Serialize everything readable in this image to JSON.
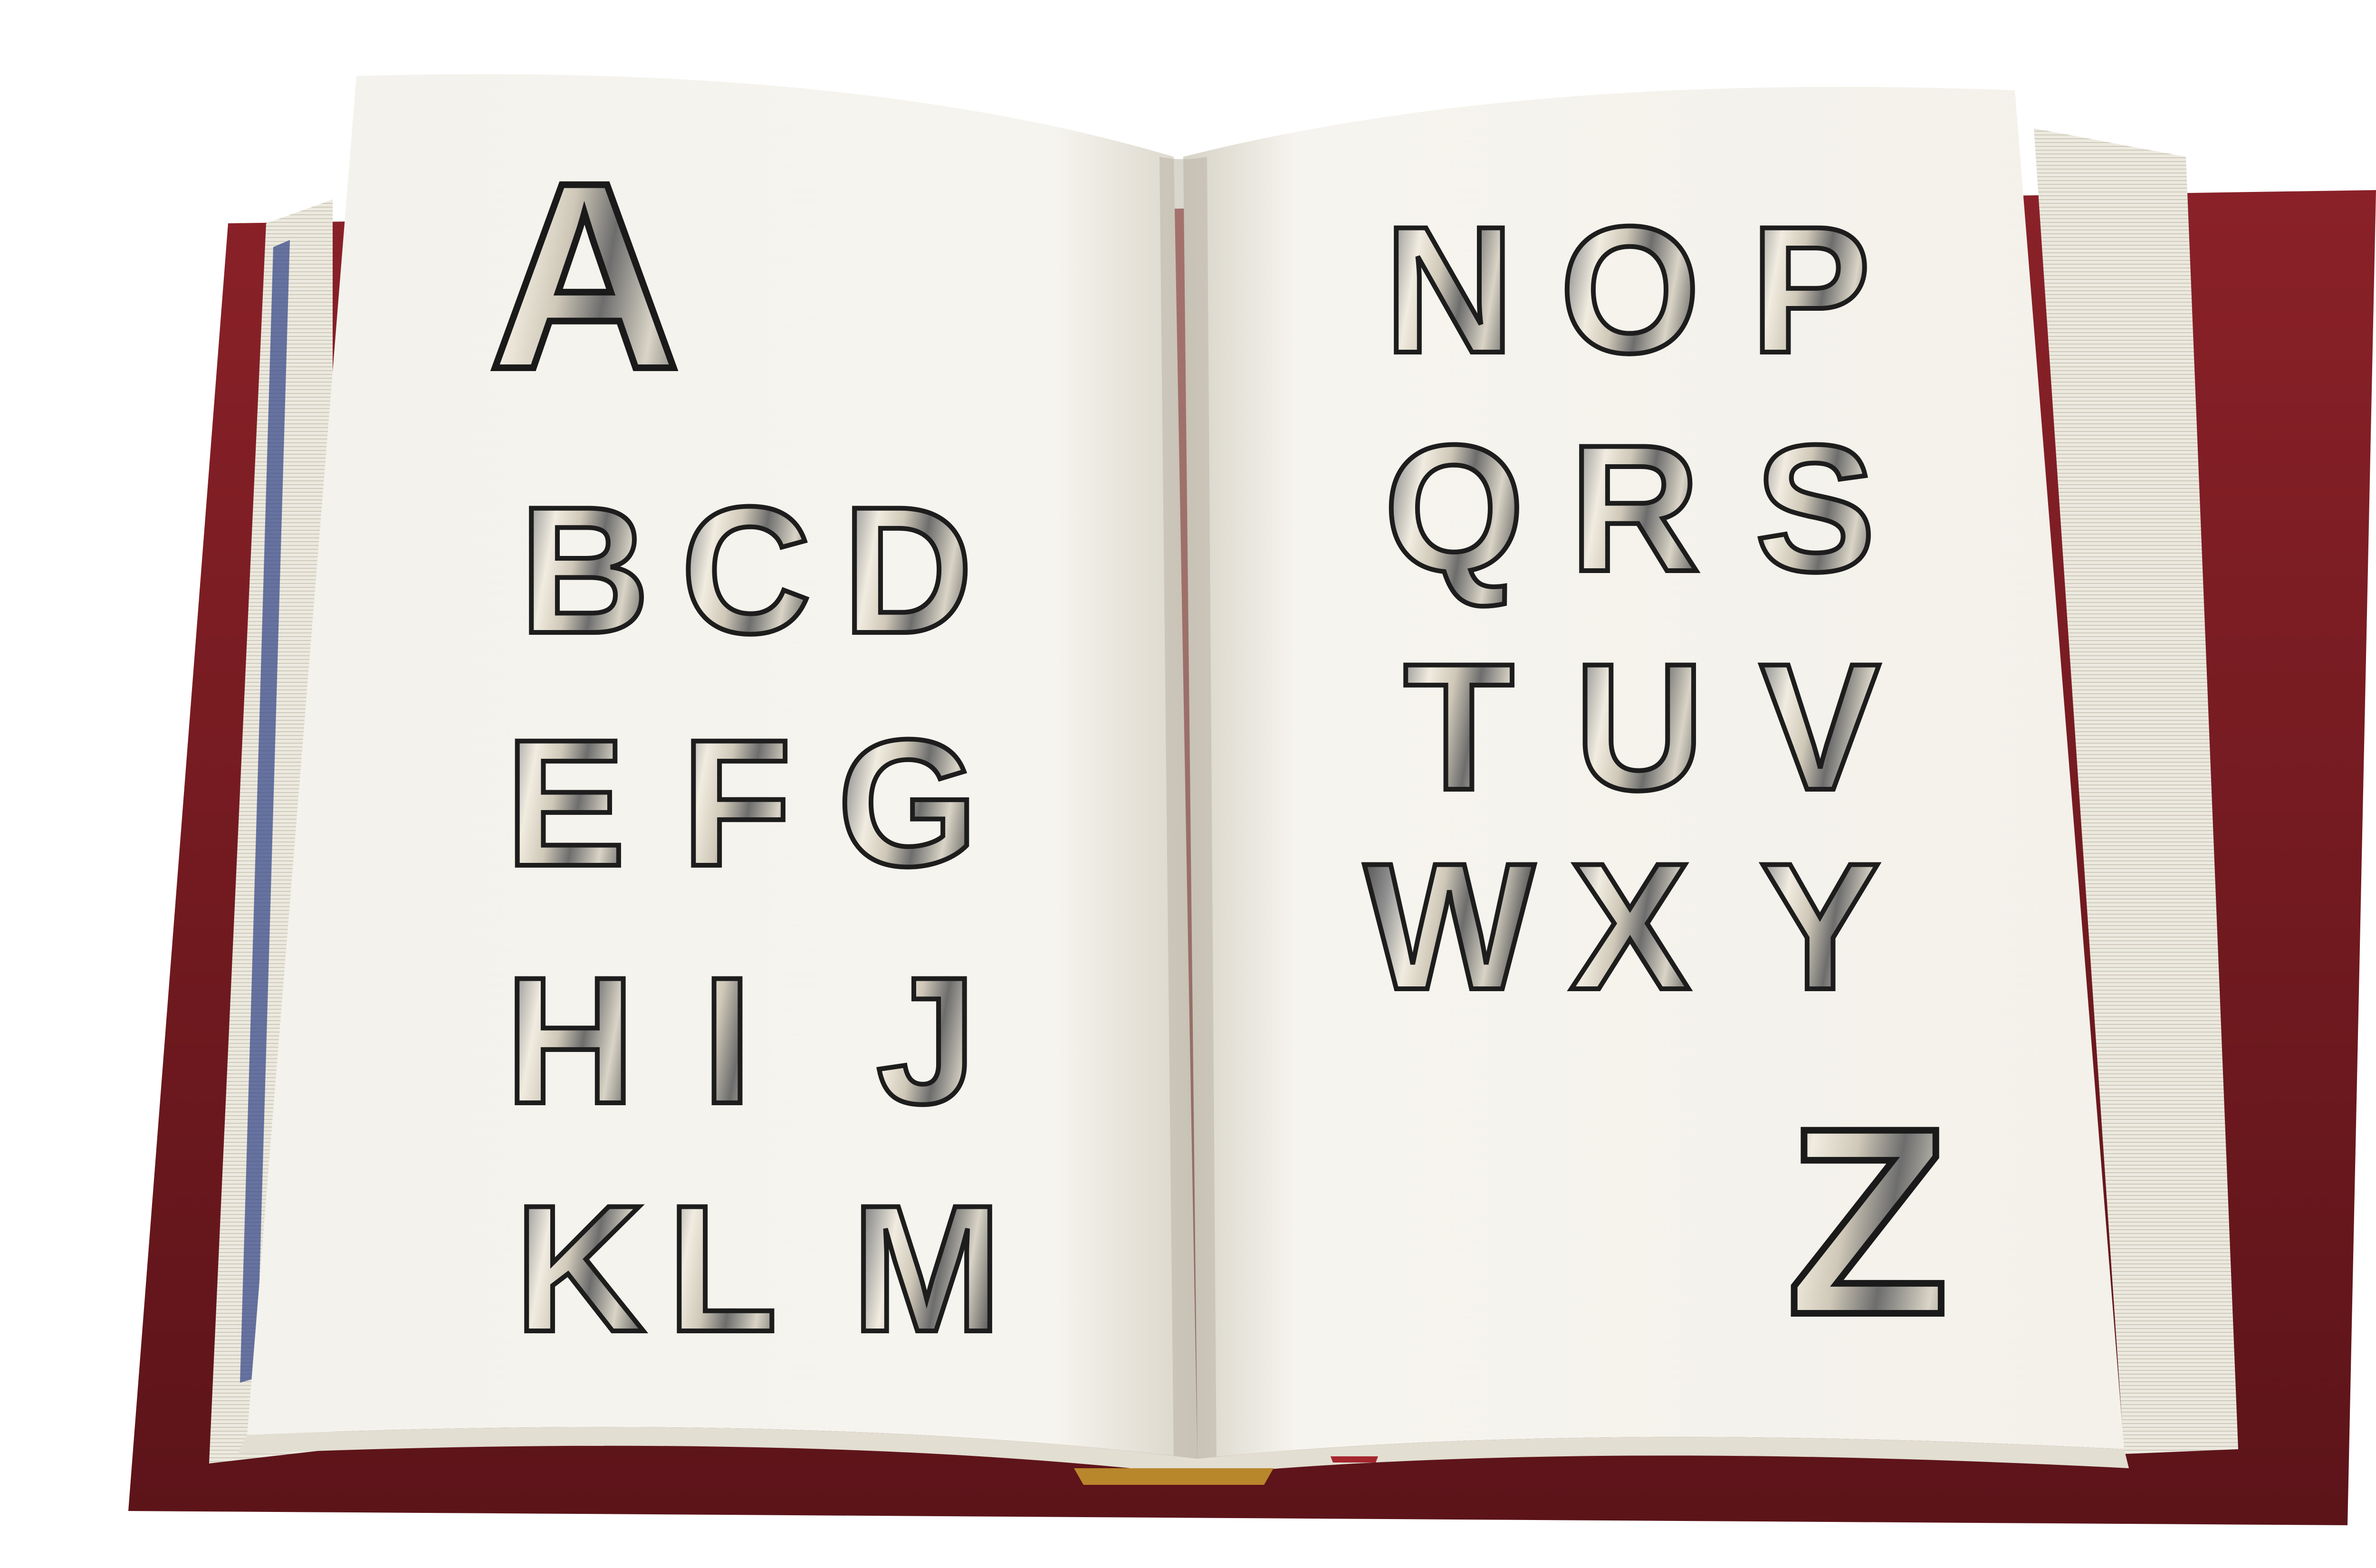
{
  "image": {
    "description_colors": {
      "cover": "#7a1c22",
      "cover_dark": "#5a1217",
      "page": "#f3f1ea",
      "page_shade": "#d9d5c8",
      "edge_band": "#3a4a8a",
      "bookmark": "#b8862b"
    }
  },
  "alphabet": {
    "left_page": [
      "A",
      "B",
      "C",
      "D",
      "E",
      "F",
      "G",
      "H",
      "I",
      "J",
      "K",
      "L",
      "M"
    ],
    "right_page": [
      "N",
      "O",
      "P",
      "Q",
      "R",
      "S",
      "T",
      "U",
      "V",
      "W",
      "X",
      "Y",
      "Z"
    ]
  }
}
